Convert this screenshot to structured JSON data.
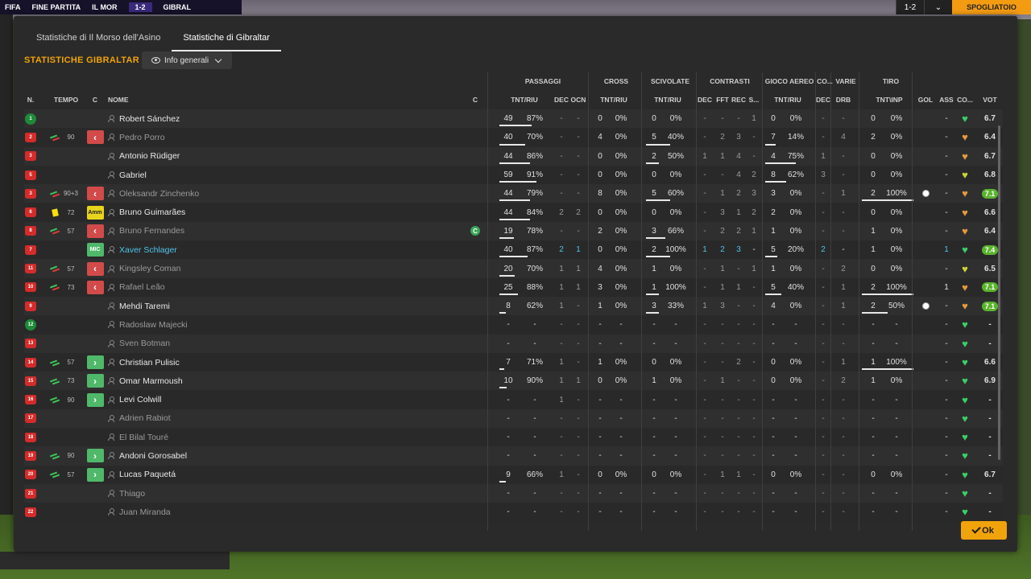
{
  "background": {
    "match_status": "FINE PARTITA",
    "home_abbr": "IL MOR",
    "score": "1-2",
    "away_abbr": "GIBRAL",
    "small_logo": "FIFA",
    "corner_score": "1-2",
    "dressing_room": "SPOGLIATOIO"
  },
  "tabs": [
    {
      "label": "Statistiche di Il Morso dell'Asino",
      "active": false
    },
    {
      "label": "Statistiche di Gibraltar",
      "active": true
    }
  ],
  "section_title": "STATISTICHE GIBRALTAR",
  "dropdown": {
    "label": "Info generali"
  },
  "groups": [
    "PASSAGGI",
    "CROSS",
    "SCIVOLATE",
    "CONTRASTI",
    "GIOCO AEREO",
    "CO...",
    "VARIE",
    "TIRO"
  ],
  "headers": {
    "num": "N.",
    "time": "TEMPO",
    "c": "C",
    "name": "NOME",
    "c2": "C",
    "p_tnt": "TNT/RIU",
    "p_dec": "DEC",
    "p_ocn": "OCN",
    "cr_tnt": "TNT/RIU",
    "sc_tnt": "TNT/RIU",
    "ct_dec": "DEC",
    "ct_fft": "FFT",
    "ct_rec": "REC",
    "ct_s": "S...",
    "ga_tnt": "TNT/RIU",
    "co_dec": "DEC",
    "va_drb": "DRB",
    "ti_tnt": "TNT\\INP",
    "gol": "GOL",
    "ass": "ASS",
    "cond": "CO...",
    "vot": "VOT"
  },
  "players": [
    {
      "num": "1",
      "gk": true,
      "sub": "",
      "min": "",
      "badge": "",
      "name": "Robert Sánchez",
      "style": "",
      "cap": "",
      "p_t": "49",
      "p_r": "87%",
      "p_bar": 0.62,
      "p_dec": "-",
      "p_ocn": "-",
      "cr_t": "0",
      "cr_r": "0%",
      "sc_t": "0",
      "sc_r": "0%",
      "sc_bar": 0,
      "ct_dec": "-",
      "ct_fft": "-",
      "ct_rec": "-",
      "ct_s": "1",
      "ga_t": "0",
      "ga_r": "0%",
      "ga_bar": 0,
      "co_dec": "-",
      "va_drb": "-",
      "ti_t": "0",
      "ti_r": "0%",
      "ti_bar": 0,
      "gol": "",
      "ass": "-",
      "cond": "green",
      "vot": "6.7",
      "vot_hi": false
    },
    {
      "num": "2",
      "gk": false,
      "sub": "out",
      "min": "90",
      "badge": "out",
      "name": "Pedro Porro",
      "style": "dim",
      "cap": "",
      "p_t": "40",
      "p_r": "70%",
      "p_bar": 0.5,
      "p_dec": "-",
      "p_ocn": "-",
      "cr_t": "4",
      "cr_r": "0%",
      "sc_t": "5",
      "sc_r": "40%",
      "sc_bar": 0.55,
      "ct_dec": "-",
      "ct_fft": "2",
      "ct_rec": "3",
      "ct_s": "-",
      "ga_t": "7",
      "ga_r": "14%",
      "ga_bar": 0.25,
      "co_dec": "-",
      "va_drb": "4",
      "ti_t": "2",
      "ti_r": "0%",
      "ti_bar": 0,
      "gol": "",
      "ass": "-",
      "cond": "orange",
      "vot": "6.4",
      "vot_hi": false
    },
    {
      "num": "3",
      "gk": false,
      "sub": "",
      "min": "",
      "badge": "",
      "name": "Antonio Rüdiger",
      "style": "",
      "cap": "",
      "p_t": "44",
      "p_r": "86%",
      "p_bar": 0.6,
      "p_dec": "-",
      "p_ocn": "-",
      "cr_t": "0",
      "cr_r": "0%",
      "sc_t": "2",
      "sc_r": "50%",
      "sc_bar": 0.3,
      "ct_dec": "1",
      "ct_fft": "1",
      "ct_rec": "4",
      "ct_s": "-",
      "ga_t": "4",
      "ga_r": "75%",
      "ga_bar": 0.75,
      "co_dec": "1",
      "va_drb": "-",
      "ti_t": "0",
      "ti_r": "0%",
      "ti_bar": 0,
      "gol": "",
      "ass": "-",
      "cond": "orange",
      "vot": "6.7",
      "vot_hi": false
    },
    {
      "num": "5",
      "gk": false,
      "sub": "",
      "min": "",
      "badge": "",
      "name": "Gabriel",
      "style": "",
      "cap": "",
      "p_t": "59",
      "p_r": "91%",
      "p_bar": 0.72,
      "p_dec": "-",
      "p_ocn": "-",
      "cr_t": "0",
      "cr_r": "0%",
      "sc_t": "0",
      "sc_r": "0%",
      "sc_bar": 0,
      "ct_dec": "-",
      "ct_fft": "-",
      "ct_rec": "4",
      "ct_s": "2",
      "ga_t": "8",
      "ga_r": "62%",
      "ga_bar": 0.52,
      "co_dec": "3",
      "va_drb": "-",
      "ti_t": "0",
      "ti_r": "0%",
      "ti_bar": 0,
      "gol": "",
      "ass": "-",
      "cond": "yellow",
      "vot": "6.8",
      "vot_hi": false
    },
    {
      "num": "3",
      "gk": false,
      "sub": "out",
      "min": "90+3",
      "badge": "out",
      "name": "Oleksandr Zinchenko",
      "style": "dim",
      "cap": "",
      "p_t": "44",
      "p_r": "79%",
      "p_bar": 0.6,
      "p_dec": "-",
      "p_ocn": "-",
      "cr_t": "8",
      "cr_r": "0%",
      "sc_t": "5",
      "sc_r": "60%",
      "sc_bar": 0.55,
      "ct_dec": "-",
      "ct_fft": "1",
      "ct_rec": "2",
      "ct_s": "3",
      "ga_t": "3",
      "ga_r": "0%",
      "ga_bar": 0,
      "co_dec": "-",
      "va_drb": "1",
      "ti_t": "2",
      "ti_r": "100%",
      "ti_bar": 1,
      "gol": "ball",
      "ass": "-",
      "cond": "orange",
      "vot": "7.1",
      "vot_hi": true
    },
    {
      "num": "6",
      "gk": false,
      "sub": "yellow",
      "min": "72",
      "badge": "amm",
      "name": "Bruno Guimarães",
      "style": "",
      "cap": "",
      "p_t": "44",
      "p_r": "84%",
      "p_bar": 0.6,
      "p_dec": "2",
      "p_ocn": "2",
      "cr_t": "0",
      "cr_r": "0%",
      "sc_t": "0",
      "sc_r": "0%",
      "sc_bar": 0,
      "ct_dec": "-",
      "ct_fft": "3",
      "ct_rec": "1",
      "ct_s": "2",
      "ga_t": "2",
      "ga_r": "0%",
      "ga_bar": 0,
      "co_dec": "-",
      "va_drb": "-",
      "ti_t": "0",
      "ti_r": "0%",
      "ti_bar": 0,
      "gol": "",
      "ass": "-",
      "cond": "orange",
      "vot": "6.6",
      "vot_hi": false
    },
    {
      "num": "8",
      "gk": false,
      "sub": "out",
      "min": "57",
      "badge": "out",
      "name": "Bruno Fernandes",
      "style": "dim",
      "cap": "C",
      "p_t": "19",
      "p_r": "78%",
      "p_bar": 0.28,
      "p_dec": "-",
      "p_ocn": "-",
      "cr_t": "2",
      "cr_r": "0%",
      "sc_t": "3",
      "sc_r": "66%",
      "sc_bar": 0.45,
      "ct_dec": "-",
      "ct_fft": "2",
      "ct_rec": "2",
      "ct_s": "1",
      "ga_t": "1",
      "ga_r": "0%",
      "ga_bar": 0,
      "co_dec": "-",
      "va_drb": "-",
      "ti_t": "1",
      "ti_r": "0%",
      "ti_bar": 0,
      "gol": "",
      "ass": "-",
      "cond": "orange",
      "vot": "6.4",
      "vot_hi": false
    },
    {
      "num": "7",
      "gk": false,
      "sub": "",
      "min": "",
      "badge": "mic",
      "name": "Xaver Schlager",
      "style": "blue",
      "cap": "",
      "p_t": "40",
      "p_r": "87%",
      "p_bar": 0.55,
      "p_dec": "2",
      "p_ocn": "1",
      "cr_t": "0",
      "cr_r": "0%",
      "sc_t": "2",
      "sc_r": "100%",
      "sc_bar": 0.55,
      "ct_dec": "1",
      "ct_fft": "2",
      "ct_rec": "3",
      "ct_s": "-",
      "ga_t": "5",
      "ga_r": "20%",
      "ga_bar": 0.3,
      "co_dec": "2",
      "va_drb": "-",
      "ti_t": "1",
      "ti_r": "0%",
      "ti_bar": 0,
      "gol": "",
      "ass": "1",
      "cond": "green",
      "vot": "7.4",
      "vot_hi": true,
      "blue": true
    },
    {
      "num": "11",
      "gk": false,
      "sub": "out",
      "min": "57",
      "badge": "out",
      "name": "Kingsley Coman",
      "style": "dim",
      "cap": "",
      "p_t": "20",
      "p_r": "70%",
      "p_bar": 0.3,
      "p_dec": "1",
      "p_ocn": "1",
      "cr_t": "4",
      "cr_r": "0%",
      "sc_t": "1",
      "sc_r": "0%",
      "sc_bar": 0,
      "ct_dec": "-",
      "ct_fft": "1",
      "ct_rec": "-",
      "ct_s": "1",
      "ga_t": "1",
      "ga_r": "0%",
      "ga_bar": 0,
      "co_dec": "-",
      "va_drb": "2",
      "ti_t": "0",
      "ti_r": "0%",
      "ti_bar": 0,
      "gol": "",
      "ass": "-",
      "cond": "yellow",
      "vot": "6.5",
      "vot_hi": false
    },
    {
      "num": "10",
      "gk": false,
      "sub": "out",
      "min": "73",
      "badge": "out",
      "name": "Rafael Leão",
      "style": "dim",
      "cap": "",
      "p_t": "25",
      "p_r": "88%",
      "p_bar": 0.36,
      "p_dec": "1",
      "p_ocn": "1",
      "cr_t": "3",
      "cr_r": "0%",
      "sc_t": "1",
      "sc_r": "100%",
      "sc_bar": 0.3,
      "ct_dec": "-",
      "ct_fft": "1",
      "ct_rec": "1",
      "ct_s": "-",
      "ga_t": "5",
      "ga_r": "40%",
      "ga_bar": 0.4,
      "co_dec": "-",
      "va_drb": "1",
      "ti_t": "2",
      "ti_r": "100%",
      "ti_bar": 1,
      "gol": "",
      "ass": "1",
      "cond": "orange",
      "vot": "7.1",
      "vot_hi": true
    },
    {
      "num": "9",
      "gk": false,
      "sub": "",
      "min": "",
      "badge": "",
      "name": "Mehdi Taremi",
      "style": "",
      "cap": "",
      "p_t": "8",
      "p_r": "62%",
      "p_bar": 0.12,
      "p_dec": "1",
      "p_ocn": "-",
      "cr_t": "1",
      "cr_r": "0%",
      "sc_t": "3",
      "sc_r": "33%",
      "sc_bar": 0.3,
      "ct_dec": "1",
      "ct_fft": "3",
      "ct_rec": "-",
      "ct_s": "-",
      "ga_t": "4",
      "ga_r": "0%",
      "ga_bar": 0,
      "co_dec": "-",
      "va_drb": "1",
      "ti_t": "2",
      "ti_r": "50%",
      "ti_bar": 0.5,
      "gol": "ball",
      "ass": "-",
      "cond": "orange",
      "vot": "7.1",
      "vot_hi": true
    },
    {
      "num": "12",
      "gk": true,
      "sub": "",
      "min": "",
      "badge": "",
      "name": "Radoslaw Majecki",
      "style": "dim",
      "cap": "",
      "empty": true,
      "cond": "green",
      "vot": "-"
    },
    {
      "num": "13",
      "gk": false,
      "sub": "",
      "min": "",
      "badge": "",
      "name": "Sven Botman",
      "style": "dim",
      "cap": "",
      "empty": true,
      "cond": "green",
      "vot": "-"
    },
    {
      "num": "14",
      "gk": false,
      "sub": "in",
      "min": "57",
      "badge": "in",
      "name": "Christian Pulisic",
      "style": "",
      "cap": "",
      "p_t": "7",
      "p_r": "71%",
      "p_bar": 0.1,
      "p_dec": "1",
      "p_ocn": "-",
      "cr_t": "1",
      "cr_r": "0%",
      "sc_t": "0",
      "sc_r": "0%",
      "sc_bar": 0,
      "ct_dec": "-",
      "ct_fft": "-",
      "ct_rec": "2",
      "ct_s": "-",
      "ga_t": "0",
      "ga_r": "0%",
      "ga_bar": 0,
      "co_dec": "-",
      "va_drb": "1",
      "ti_t": "1",
      "ti_r": "100%",
      "ti_bar": 1,
      "gol": "",
      "ass": "-",
      "cond": "green",
      "vot": "6.6",
      "vot_hi": false
    },
    {
      "num": "15",
      "gk": false,
      "sub": "in",
      "min": "73",
      "badge": "in",
      "name": "Omar Marmoush",
      "style": "",
      "cap": "",
      "p_t": "10",
      "p_r": "90%",
      "p_bar": 0.14,
      "p_dec": "1",
      "p_ocn": "1",
      "cr_t": "0",
      "cr_r": "0%",
      "sc_t": "1",
      "sc_r": "0%",
      "sc_bar": 0,
      "ct_dec": "-",
      "ct_fft": "1",
      "ct_rec": "-",
      "ct_s": "-",
      "ga_t": "0",
      "ga_r": "0%",
      "ga_bar": 0,
      "co_dec": "-",
      "va_drb": "2",
      "ti_t": "1",
      "ti_r": "0%",
      "ti_bar": 0,
      "gol": "",
      "ass": "-",
      "cond": "green",
      "vot": "6.9",
      "vot_hi": false
    },
    {
      "num": "16",
      "gk": false,
      "sub": "in",
      "min": "90",
      "badge": "in",
      "name": "Levi Colwill",
      "style": "",
      "cap": "",
      "p_t": "-",
      "p_r": "-",
      "p_bar": 0,
      "p_dec": "1",
      "p_ocn": "-",
      "cr_t": "-",
      "cr_r": "-",
      "sc_t": "-",
      "sc_r": "-",
      "sc_bar": 0,
      "ct_dec": "-",
      "ct_fft": "-",
      "ct_rec": "-",
      "ct_s": "-",
      "ga_t": "-",
      "ga_r": "-",
      "ga_bar": 0,
      "co_dec": "-",
      "va_drb": "-",
      "ti_t": "-",
      "ti_r": "-",
      "ti_bar": 0,
      "gol": "",
      "ass": "-",
      "cond": "green",
      "vot": "-",
      "vot_hi": false
    },
    {
      "num": "17",
      "gk": false,
      "sub": "",
      "min": "",
      "badge": "",
      "name": "Adrien Rabiot",
      "style": "dim",
      "cap": "",
      "empty": true,
      "cond": "green",
      "vot": "-"
    },
    {
      "num": "18",
      "gk": false,
      "sub": "",
      "min": "",
      "badge": "",
      "name": "El Bilal Touré",
      "style": "dim",
      "cap": "",
      "empty": true,
      "cond": "green",
      "vot": "-"
    },
    {
      "num": "19",
      "gk": false,
      "sub": "in",
      "min": "90",
      "badge": "in",
      "name": "Andoni Gorosabel",
      "style": "",
      "cap": "",
      "p_t": "-",
      "p_r": "-",
      "p_bar": 0,
      "p_dec": "-",
      "p_ocn": "-",
      "cr_t": "-",
      "cr_r": "-",
      "sc_t": "-",
      "sc_r": "-",
      "sc_bar": 0,
      "ct_dec": "-",
      "ct_fft": "-",
      "ct_rec": "-",
      "ct_s": "-",
      "ga_t": "-",
      "ga_r": "-",
      "ga_bar": 0,
      "co_dec": "-",
      "va_drb": "-",
      "ti_t": "-",
      "ti_r": "-",
      "ti_bar": 0,
      "gol": "",
      "ass": "-",
      "cond": "green",
      "vot": "-",
      "vot_hi": false
    },
    {
      "num": "20",
      "gk": false,
      "sub": "in",
      "min": "57",
      "badge": "in",
      "name": "Lucas Paquetá",
      "style": "",
      "cap": "",
      "p_t": "9",
      "p_r": "66%",
      "p_bar": 0.12,
      "p_dec": "1",
      "p_ocn": "-",
      "cr_t": "0",
      "cr_r": "0%",
      "sc_t": "0",
      "sc_r": "0%",
      "sc_bar": 0,
      "ct_dec": "-",
      "ct_fft": "1",
      "ct_rec": "1",
      "ct_s": "-",
      "ga_t": "0",
      "ga_r": "0%",
      "ga_bar": 0,
      "co_dec": "-",
      "va_drb": "-",
      "ti_t": "0",
      "ti_r": "0%",
      "ti_bar": 0,
      "gol": "",
      "ass": "-",
      "cond": "green",
      "vot": "6.7",
      "vot_hi": false
    },
    {
      "num": "21",
      "gk": false,
      "sub": "",
      "min": "",
      "badge": "",
      "name": "Thiago",
      "style": "dim",
      "cap": "",
      "empty": true,
      "cond": "green",
      "vot": "-"
    },
    {
      "num": "22",
      "gk": false,
      "sub": "",
      "min": "",
      "badge": "",
      "name": "Juan Miranda",
      "style": "dim",
      "cap": "",
      "empty": true,
      "cond": "green",
      "vot": "-"
    }
  ],
  "ok_button": {
    "label": "Ok"
  },
  "colors": {
    "accent": "#f0a30a",
    "shirt": "#d42b2b",
    "gk": "#1f8a3a",
    "sub_in": "#4fb86a",
    "sub_out": "#d24a4a",
    "rating_hi": "#5ab32c"
  }
}
